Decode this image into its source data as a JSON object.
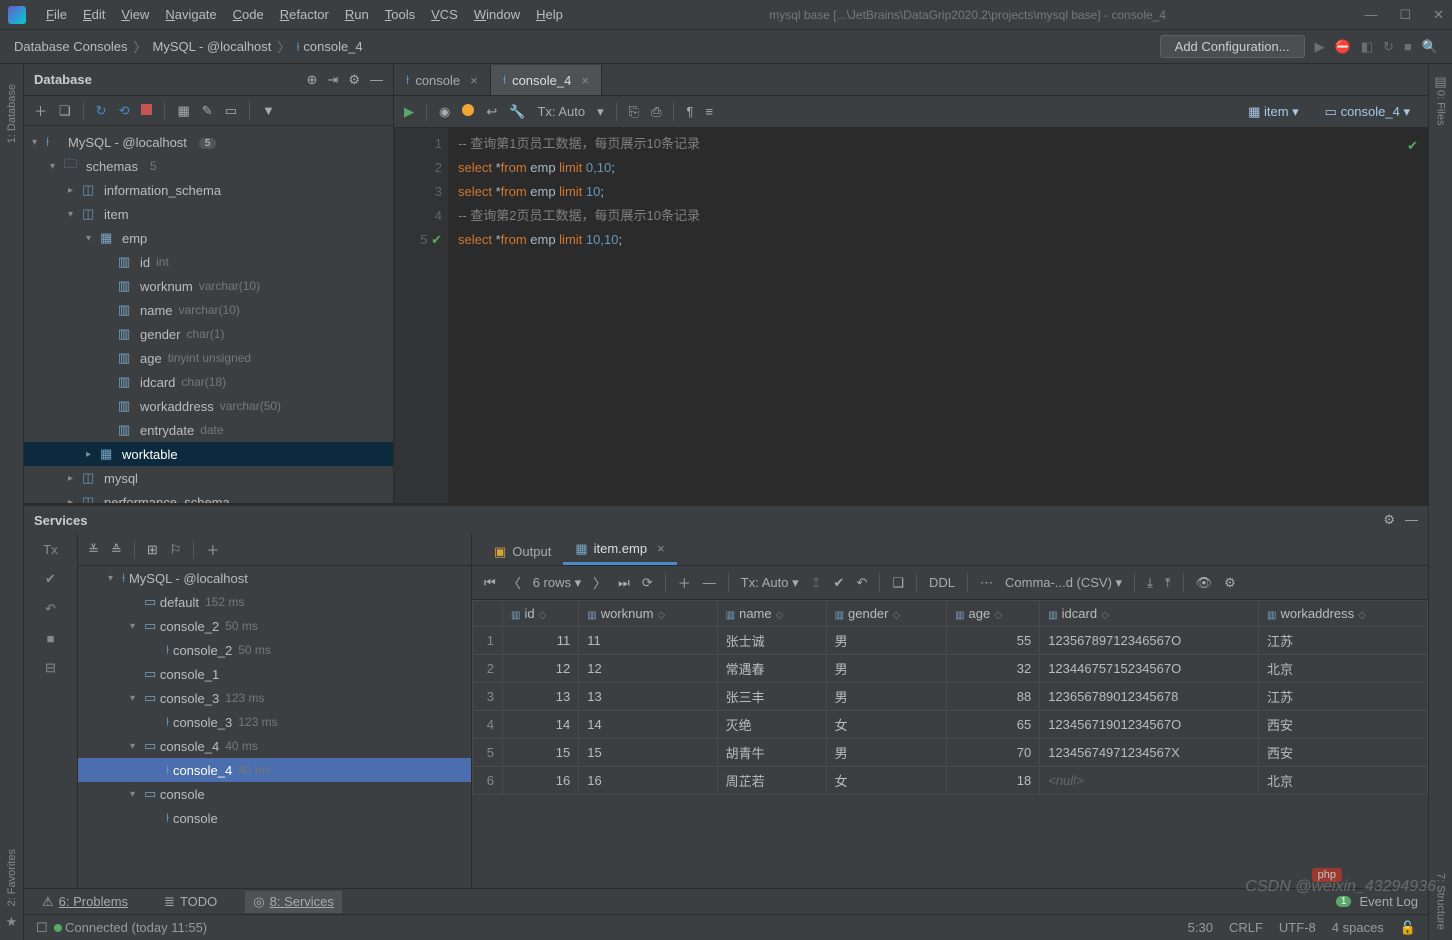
{
  "window": {
    "title": "mysql base [...\\JetBrains\\DataGrip2020.2\\projects\\mysql base] - console_4",
    "menu": [
      "File",
      "Edit",
      "View",
      "Navigate",
      "Code",
      "Refactor",
      "Run",
      "Tools",
      "VCS",
      "Window",
      "Help"
    ]
  },
  "breadcrumb": [
    "Database Consoles",
    "MySQL - @localhost",
    "console_4"
  ],
  "nav": {
    "add_config": "Add Configuration..."
  },
  "database_panel": {
    "title": "Database",
    "datasource": {
      "name": "MySQL - @localhost",
      "count": "5"
    },
    "schemas_label": "schemas",
    "schemas_count": "5",
    "schemas": [
      "information_schema",
      "item",
      "mysql",
      "performance_schema"
    ],
    "item_tables": {
      "emp": {
        "columns": [
          {
            "name": "id",
            "type": "int"
          },
          {
            "name": "worknum",
            "type": "varchar(10)"
          },
          {
            "name": "name",
            "type": "varchar(10)"
          },
          {
            "name": "gender",
            "type": "char(1)"
          },
          {
            "name": "age",
            "type": "tinyint unsigned"
          },
          {
            "name": "idcard",
            "type": "char(18)"
          },
          {
            "name": "workaddress",
            "type": "varchar(50)"
          },
          {
            "name": "entrydate",
            "type": "date"
          }
        ]
      },
      "worktable": "worktable"
    }
  },
  "editor": {
    "tabs": [
      {
        "name": "console"
      },
      {
        "name": "console_4",
        "active": true
      }
    ],
    "tx": "Tx: Auto",
    "chips": {
      "schema": "item",
      "console": "console_4"
    },
    "lines": [
      {
        "n": "1",
        "type": "comment",
        "text": "-- 查询第1页员工数据，每页展示10条记录"
      },
      {
        "n": "2",
        "type": "sql",
        "kw1": "select",
        "star": "*",
        "kw2": "from",
        "tbl": "emp",
        "kw3": "limit",
        "v": "0,10"
      },
      {
        "n": "3",
        "type": "sql",
        "kw1": "select",
        "star": "*",
        "kw2": "from",
        "tbl": "emp",
        "kw3": "limit",
        "v": "10"
      },
      {
        "n": "4",
        "type": "comment",
        "text": "-- 查询第2页员工数据，每页展示10条记录"
      },
      {
        "n": "5",
        "type": "sql",
        "kw1": "select",
        "star": "*",
        "kw2": "from",
        "tbl": "emp",
        "kw3": "limit",
        "v": "10,10",
        "check": true
      }
    ]
  },
  "services": {
    "title": "Services",
    "tx_label": "Tx",
    "tree": [
      {
        "depth": 1,
        "arrow": "▾",
        "icon": "ds",
        "label": "MySQL - @localhost"
      },
      {
        "depth": 2,
        "arrow": "",
        "icon": "cfg",
        "label": "default",
        "dim": "152 ms"
      },
      {
        "depth": 2,
        "arrow": "▾",
        "icon": "cfg",
        "label": "console_2",
        "dim": "50 ms"
      },
      {
        "depth": 3,
        "arrow": "",
        "icon": "q",
        "label": "console_2",
        "dim": "50 ms"
      },
      {
        "depth": 2,
        "arrow": "",
        "icon": "cfg",
        "label": "console_1"
      },
      {
        "depth": 2,
        "arrow": "▾",
        "icon": "cfg",
        "label": "console_3",
        "dim": "123 ms"
      },
      {
        "depth": 3,
        "arrow": "",
        "icon": "q",
        "label": "console_3",
        "dim": "123 ms"
      },
      {
        "depth": 2,
        "arrow": "▾",
        "icon": "cfg",
        "label": "console_4",
        "dim": "40 ms"
      },
      {
        "depth": 3,
        "arrow": "",
        "icon": "q",
        "label": "console_4",
        "dim": "40 ms",
        "sel": true
      },
      {
        "depth": 2,
        "arrow": "▾",
        "icon": "cfg",
        "label": "console"
      },
      {
        "depth": 3,
        "arrow": "",
        "icon": "q",
        "label": "console"
      }
    ],
    "output_tabs": {
      "output": "Output",
      "table": "item.emp"
    },
    "grid_toolbar": {
      "rows": "6 rows",
      "tx": "Tx: Auto",
      "ddl": "DDL",
      "csv": "Comma-...d (CSV)"
    },
    "columns": [
      "id",
      "worknum",
      "name",
      "gender",
      "age",
      "idcard",
      "workaddress"
    ],
    "rows": [
      {
        "n": "1",
        "id": "11",
        "worknum": "11",
        "name": "张士诚",
        "gender": "男",
        "age": "55",
        "idcard": "12356789712346567O",
        "workaddress": "江苏"
      },
      {
        "n": "2",
        "id": "12",
        "worknum": "12",
        "name": "常遇春",
        "gender": "男",
        "age": "32",
        "idcard": "12344675715234567O",
        "workaddress": "北京"
      },
      {
        "n": "3",
        "id": "13",
        "worknum": "13",
        "name": "张三丰",
        "gender": "男",
        "age": "88",
        "idcard": "123656789012345678",
        "workaddress": "江苏"
      },
      {
        "n": "4",
        "id": "14",
        "worknum": "14",
        "name": "灭绝",
        "gender": "女",
        "age": "65",
        "idcard": "12345671901234567O",
        "workaddress": "西安"
      },
      {
        "n": "5",
        "id": "15",
        "worknum": "15",
        "name": "胡青牛",
        "gender": "男",
        "age": "70",
        "idcard": "12345674971234567X",
        "workaddress": "西安"
      },
      {
        "n": "6",
        "id": "16",
        "worknum": "16",
        "name": "周芷若",
        "gender": "女",
        "age": "18",
        "idcard": "<null>",
        "workaddress": "北京"
      }
    ]
  },
  "bottom_tabs": {
    "problems": "6: Problems",
    "todo": "TODO",
    "services": "8: Services"
  },
  "status": {
    "left": "Connected (today 11:55)",
    "pos": "5:30",
    "crlf": "CRLF",
    "enc": "UTF-8",
    "indent": "4 spaces",
    "event": "Event Log",
    "event_badge": "1"
  },
  "side_labels": {
    "database": "1: Database",
    "favorites": "2: Favorites",
    "files": "0: Files",
    "structure": "7: Structure"
  },
  "watermark": "CSDN @weixin_43294936",
  "php_badge": "php"
}
